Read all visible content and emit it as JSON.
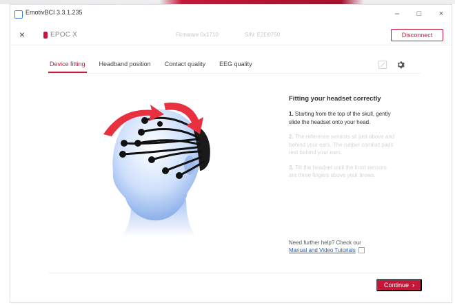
{
  "window": {
    "title": "EmotivBCI 3.3.1.235",
    "controls": {
      "minimize": "–",
      "maximize": "□",
      "close": "×"
    }
  },
  "header": {
    "close": "×",
    "device_name": "EPOC X",
    "firmware": "Firmware 0x1710",
    "serial": "S/N: E2D0750",
    "disconnect_label": "Disconnect"
  },
  "tabs": [
    {
      "label": "Device fitting",
      "active": true
    },
    {
      "label": "Headband position",
      "active": false
    },
    {
      "label": "Contact quality",
      "active": false
    },
    {
      "label": "EEG quality",
      "active": false
    }
  ],
  "panel": {
    "title": "Fitting your headset correctly",
    "steps": [
      {
        "num": "1.",
        "text": "Starting from the top of the skull, gently slide the headset onto your head."
      },
      {
        "num": "2.",
        "text": "The reference sensors sit just above and behind your ears. The rubber comfort pads rest behind your ears."
      },
      {
        "num": "3.",
        "text": "Tilt the headset until the front sensors are three fingers above your brows."
      }
    ],
    "help_text": "Need further help? Check our",
    "help_link": "Manual and Video Tutorials"
  },
  "footer": {
    "continue_label": "Continue"
  },
  "colors": {
    "accent": "#c6173b",
    "link": "#2a5db0"
  },
  "icons": {
    "app": "app-window-icon",
    "gear": "gear-icon",
    "external": "external-link-icon",
    "continue": "chevron-right-icon"
  }
}
